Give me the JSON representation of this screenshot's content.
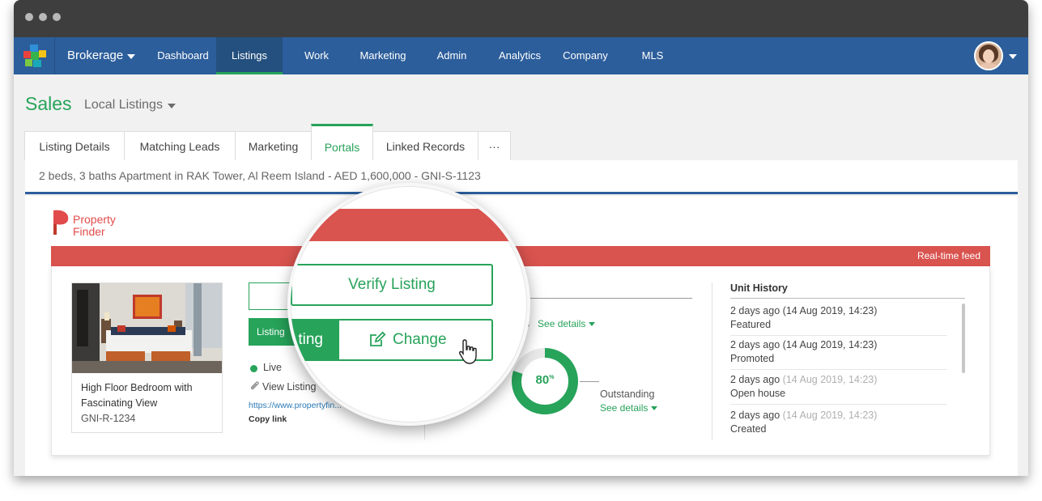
{
  "nav": {
    "brokerage": "Brokerage",
    "items": [
      {
        "label": "Dashboard"
      },
      {
        "label": "Listings"
      },
      {
        "label": "Work"
      },
      {
        "label": "Marketing"
      },
      {
        "label": "Admin"
      },
      {
        "label": "Analytics"
      },
      {
        "label": "Company"
      },
      {
        "label": "MLS"
      }
    ],
    "active": "Listings"
  },
  "page": {
    "title": "Sales",
    "scope": "Local Listings"
  },
  "tabs": [
    {
      "label": "Listing Details"
    },
    {
      "label": "Matching Leads"
    },
    {
      "label": "Marketing"
    },
    {
      "label": "Portals"
    },
    {
      "label": "Linked Records"
    },
    {
      "label": "···"
    }
  ],
  "active_tab": "Portals",
  "listing_summary": "2 beds, 3 baths Apartment in RAK Tower, Al Reem Island - AED 1,600,000 - GNI-S-1123",
  "portal": {
    "name_line1": "Property",
    "name_line2": "Finder",
    "feed_label": "Real-time feed",
    "brand_color": "#d9534f"
  },
  "listing_card": {
    "title": "High Floor Bedroom with Fascinating View",
    "ref": "GNI-R-1234"
  },
  "actions": {
    "listing_short": "Listing",
    "status": "Live",
    "view_listing": "View Listing",
    "url": "https://www.propertyfin...",
    "copy_link": "Copy link"
  },
  "stats": {
    "partial_label": "s",
    "see_details": "See details",
    "donut_value": "80",
    "donut_unit": "%",
    "donut_fraction": 0.8,
    "outstanding": "Outstanding"
  },
  "unit_history": {
    "title": "Unit History",
    "items": [
      {
        "ago": "2 days ago",
        "when": "(14 Aug 2019, 14:23)",
        "event": "Featured",
        "dim": false
      },
      {
        "ago": "2 days ago",
        "when": "(14 Aug 2019, 14:23)",
        "event": "Promoted",
        "dim": false
      },
      {
        "ago": "2 days ago",
        "when": "(14 Aug 2019, 14:23)",
        "event": "Open house",
        "dim": true
      },
      {
        "ago": "2 days ago",
        "when": "(14 Aug 2019, 14:23)",
        "event": "Created",
        "dim": true
      }
    ]
  },
  "magnifier": {
    "verify": "Verify Listing",
    "partial": "ting",
    "change": "Change"
  },
  "colors": {
    "nav": "#2c5e9b",
    "green": "#27a35a",
    "red": "#d9534f"
  }
}
